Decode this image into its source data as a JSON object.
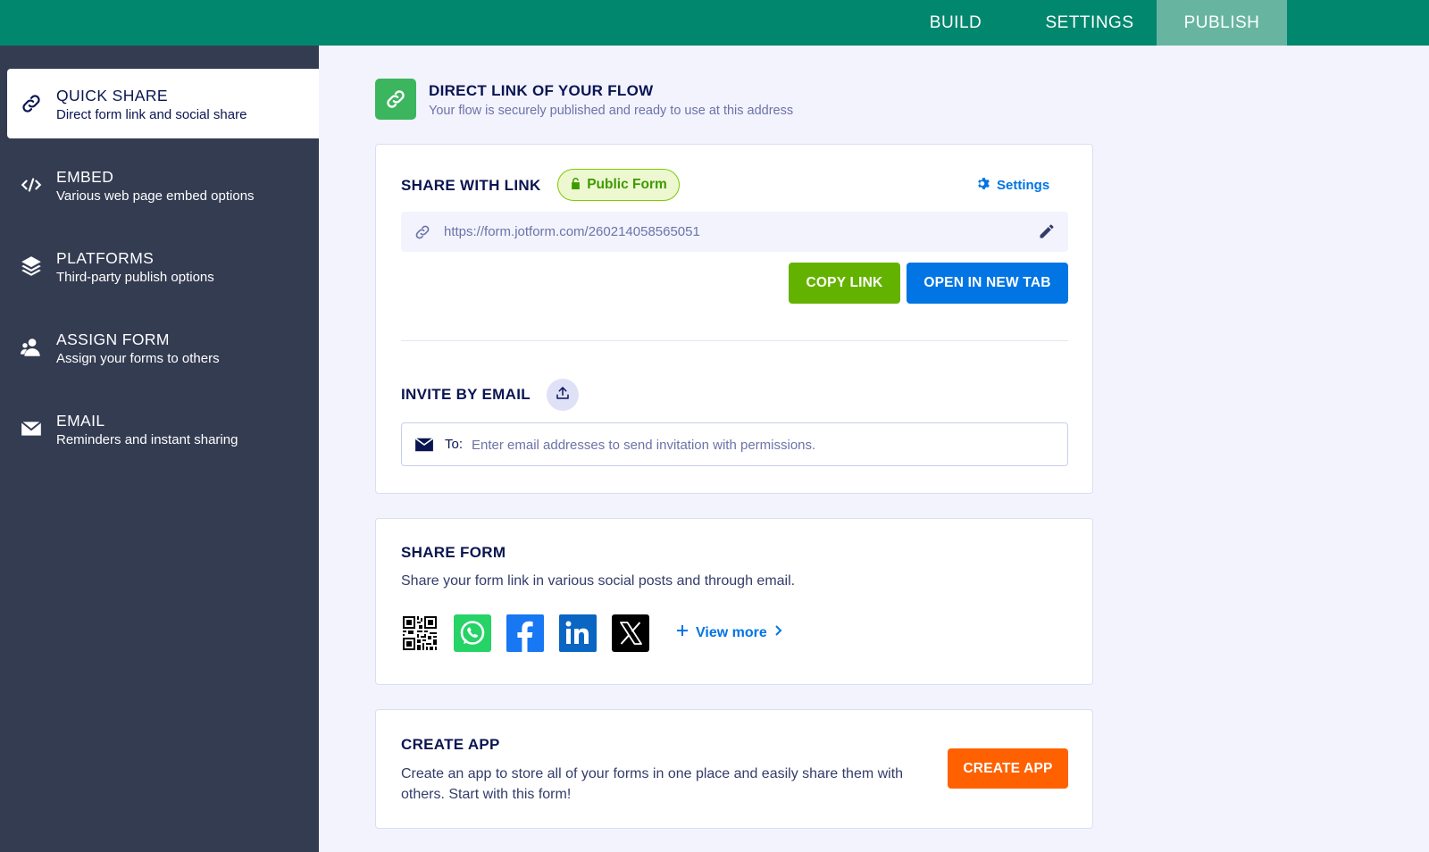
{
  "topnav": {
    "tabs": [
      {
        "label": "BUILD"
      },
      {
        "label": "SETTINGS"
      },
      {
        "label": "PUBLISH",
        "active": true
      }
    ]
  },
  "sidebar": {
    "items": [
      {
        "title": "QUICK SHARE",
        "subtitle": "Direct form link and social share",
        "icon": "link-icon",
        "active": true
      },
      {
        "title": "EMBED",
        "subtitle": "Various web page embed options",
        "icon": "code-icon"
      },
      {
        "title": "PLATFORMS",
        "subtitle": "Third-party publish options",
        "icon": "layers-icon"
      },
      {
        "title": "ASSIGN FORM",
        "subtitle": "Assign your forms to others",
        "icon": "users-icon"
      },
      {
        "title": "EMAIL",
        "subtitle": "Reminders and instant sharing",
        "icon": "envelope-icon"
      }
    ]
  },
  "header": {
    "title": "DIRECT LINK OF YOUR FLOW",
    "subtitle": "Your flow is securely published and ready to use at this address"
  },
  "share_link": {
    "title": "SHARE WITH LINK",
    "badge": "Public Form",
    "settings_label": "Settings",
    "url": "https://form.jotform.com/260214058565051",
    "copy_label": "COPY LINK",
    "open_label": "OPEN IN NEW TAB"
  },
  "invite": {
    "title": "INVITE BY EMAIL",
    "to_label": "To:",
    "placeholder": "Enter email addresses to send invitation with permissions."
  },
  "share_form": {
    "title": "SHARE FORM",
    "description": "Share your form link in various social posts and through email.",
    "socials": [
      "qr-code-icon",
      "whatsapp-icon",
      "facebook-icon",
      "linkedin-icon",
      "x-icon"
    ],
    "view_more": "View more"
  },
  "create_app": {
    "title": "CREATE APP",
    "description": "Create an app to store all of your forms in one place and easily share them with others. Start with this form!",
    "button": "CREATE APP"
  },
  "colors": {
    "topbar": "#01876e",
    "sidebar": "#343c52",
    "accent_blue": "#0075e3",
    "green": "#64b200",
    "orange": "#ff6100"
  }
}
